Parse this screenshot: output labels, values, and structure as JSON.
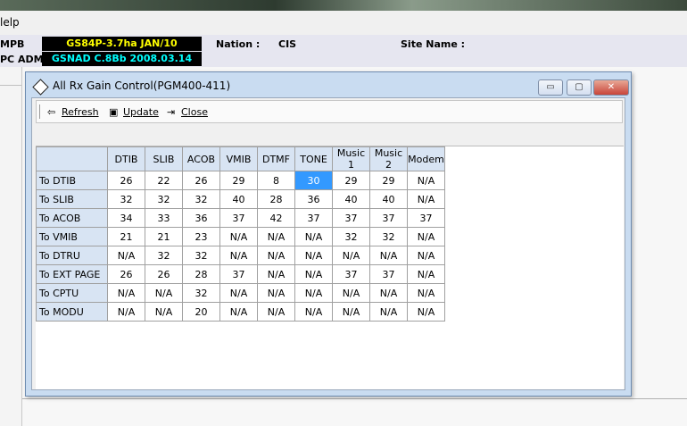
{
  "menu": {
    "help_label": "lelp"
  },
  "info": {
    "mpb_label": "MPB",
    "mpb_value": "GS84P-3.7ha JAN/10",
    "pcadm_label": "PC ADM",
    "pcadm_value": "GSNAD C.8Bb 2008.03.14",
    "nation_label": "Nation :",
    "nation_value": "CIS",
    "site_label": "Site Name :",
    "site_value": ""
  },
  "window": {
    "title": "All Rx Gain Control(PGM400-411)",
    "min_symbol": "▭",
    "max_symbol": "▢",
    "close_symbol": "✕"
  },
  "toolbar": {
    "refresh_label": "Refresh",
    "update_label": "Update",
    "close_label": "Close"
  },
  "grid": {
    "columns": [
      "DTIB",
      "SLIB",
      "ACOB",
      "VMIB",
      "DTMF",
      "TONE",
      "Music 1",
      "Music 2",
      "Modem"
    ],
    "rows": [
      {
        "label": "To DTIB",
        "cells": [
          "26",
          "22",
          "26",
          "29",
          "8",
          "30",
          "29",
          "29",
          "N/A"
        ]
      },
      {
        "label": "To SLIB",
        "cells": [
          "32",
          "32",
          "32",
          "40",
          "28",
          "36",
          "40",
          "40",
          "N/A"
        ]
      },
      {
        "label": "To ACOB",
        "cells": [
          "34",
          "33",
          "36",
          "37",
          "42",
          "37",
          "37",
          "37",
          "37"
        ]
      },
      {
        "label": "To VMIB",
        "cells": [
          "21",
          "21",
          "23",
          "N/A",
          "N/A",
          "N/A",
          "32",
          "32",
          "N/A"
        ]
      },
      {
        "label": "To DTRU",
        "cells": [
          "N/A",
          "32",
          "32",
          "N/A",
          "N/A",
          "N/A",
          "N/A",
          "N/A",
          "N/A"
        ]
      },
      {
        "label": "To EXT PAGE",
        "cells": [
          "26",
          "26",
          "28",
          "37",
          "N/A",
          "N/A",
          "37",
          "37",
          "N/A"
        ]
      },
      {
        "label": "To CPTU",
        "cells": [
          "N/A",
          "N/A",
          "32",
          "N/A",
          "N/A",
          "N/A",
          "N/A",
          "N/A",
          "N/A"
        ]
      },
      {
        "label": "To MODU",
        "cells": [
          "N/A",
          "N/A",
          "20",
          "N/A",
          "N/A",
          "N/A",
          "N/A",
          "N/A",
          "N/A"
        ]
      }
    ],
    "selected": {
      "row": 0,
      "col": 5
    }
  },
  "colors": {
    "mpb_value": "#ffff00",
    "pcadm_value": "#00ffff",
    "selection": "#3399ff"
  }
}
